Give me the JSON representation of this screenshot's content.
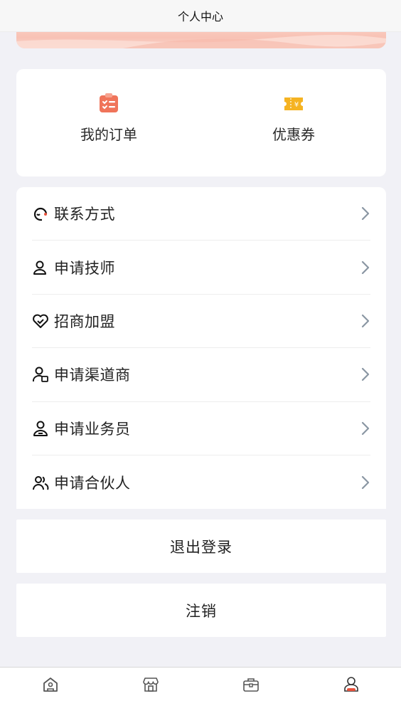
{
  "header": {
    "title": "个人中心"
  },
  "quick_actions": [
    {
      "label": "我的订单",
      "icon": "orders-clipboard-icon",
      "color": "#f0745a"
    },
    {
      "label": "优惠券",
      "icon": "coupon-ticket-icon",
      "color": "#f5b322"
    }
  ],
  "menu": [
    {
      "label": "联系方式",
      "icon": "headset-icon"
    },
    {
      "label": "申请技师",
      "icon": "user-outline-icon"
    },
    {
      "label": "招商加盟",
      "icon": "handshake-heart-icon"
    },
    {
      "label": "申请渠道商",
      "icon": "user-briefcase-icon"
    },
    {
      "label": "申请业务员",
      "icon": "user-badge-icon"
    },
    {
      "label": "申请合伙人",
      "icon": "users-group-icon"
    }
  ],
  "actions": {
    "logout": "退出登录",
    "cancel": "注销"
  },
  "tabbar": [
    {
      "icon": "home-icon",
      "active": false
    },
    {
      "icon": "store-icon",
      "active": false
    },
    {
      "icon": "briefcase-icon",
      "active": false
    },
    {
      "icon": "profile-icon",
      "active": true
    }
  ],
  "colors": {
    "accent": "#e8523c",
    "background": "#f1f1f6",
    "banner": "#f8c2b5"
  }
}
